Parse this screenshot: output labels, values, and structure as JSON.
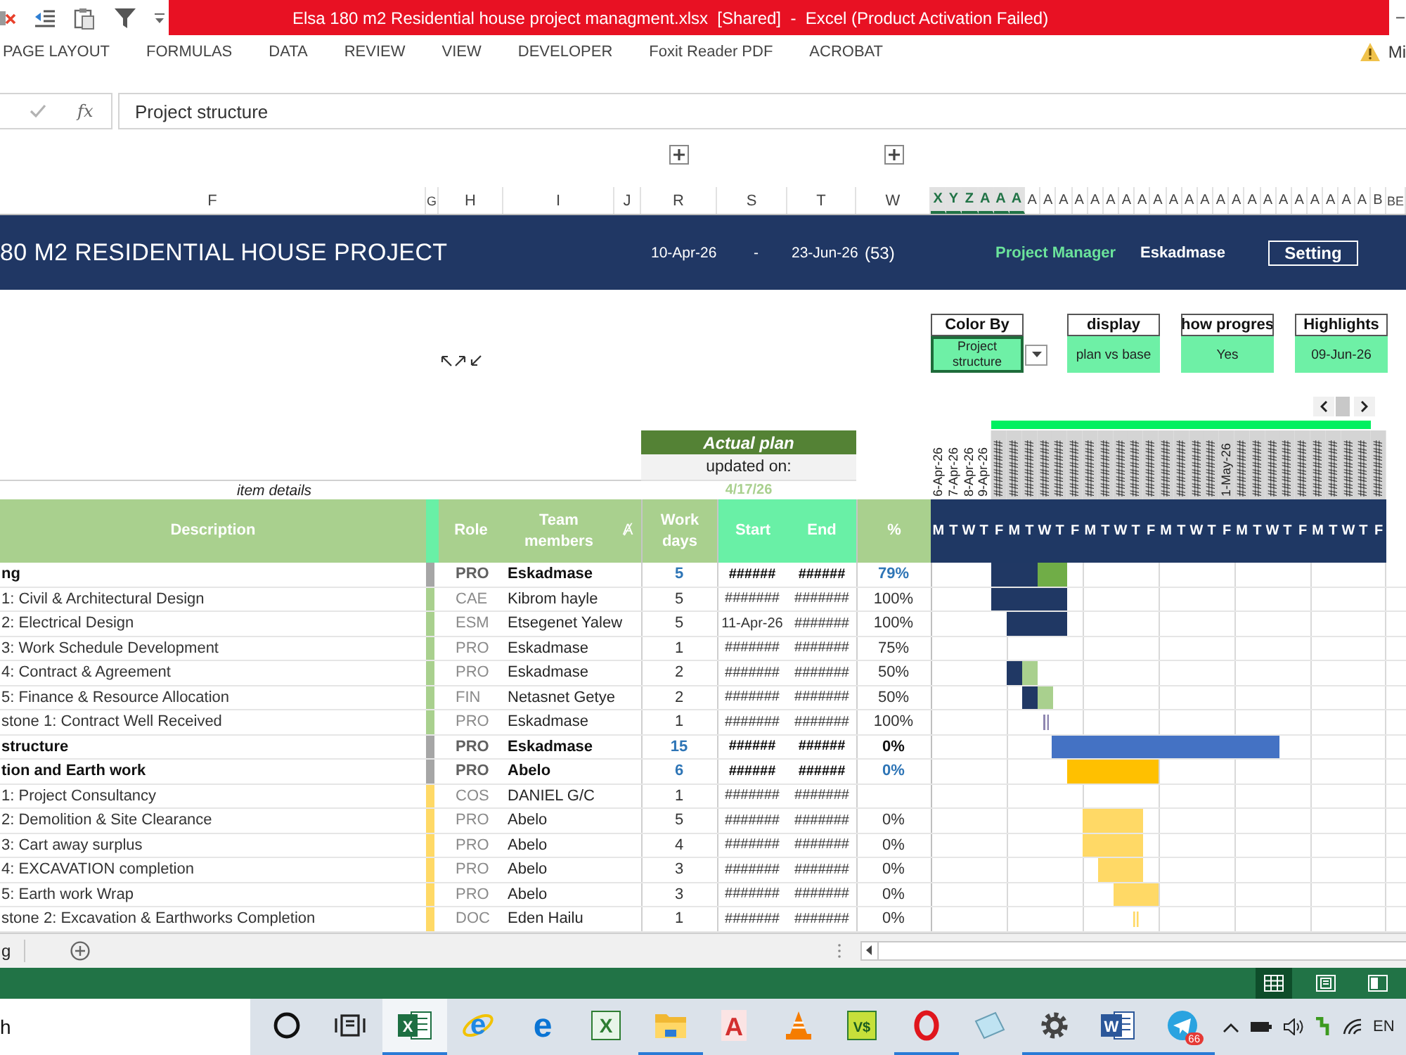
{
  "title_bar": {
    "title": "Elsa 180 m2 Residential house project managment.xlsx  [Shared]  -  Excel (Product Activation Failed)"
  },
  "ribbon": {
    "tabs": [
      {
        "label": "PAGE LAYOUT",
        "selected": false
      },
      {
        "label": "FORMULAS",
        "selected": false
      },
      {
        "label": "DATA",
        "selected": false
      },
      {
        "label": "REVIEW",
        "selected": false
      },
      {
        "label": "VIEW",
        "selected": false
      },
      {
        "label": "DEVELOPER",
        "selected": false
      },
      {
        "label": "Foxit Reader PDF",
        "selected": false
      },
      {
        "label": "ACROBAT",
        "selected": false
      }
    ],
    "account": "Mi"
  },
  "formula_bar": {
    "function_label": "fx",
    "content": "Project structure"
  },
  "column_headers": [
    {
      "label": "F",
      "selected": false
    },
    {
      "label": "G",
      "selected": false
    },
    {
      "label": "H",
      "selected": false
    },
    {
      "label": "I",
      "selected": false
    },
    {
      "label": "J",
      "selected": false
    },
    {
      "label": "R",
      "selected": false
    },
    {
      "label": "S",
      "selected": false
    },
    {
      "label": "T",
      "selected": false
    },
    {
      "label": "W",
      "selected": false
    },
    {
      "label": "X",
      "selected": true
    },
    {
      "label": "Y",
      "selected": true
    },
    {
      "label": "Z",
      "selected": true
    },
    {
      "label": "A",
      "selected": true
    },
    {
      "label": "A",
      "selected": true
    },
    {
      "label": "A",
      "selected": true
    },
    {
      "label": "A",
      "selected": false
    },
    {
      "label": "A",
      "selected": false
    },
    {
      "label": "A",
      "selected": false
    },
    {
      "label": "A",
      "selected": false
    },
    {
      "label": "A",
      "selected": false
    },
    {
      "label": "A",
      "selected": false
    },
    {
      "label": "A",
      "selected": false
    },
    {
      "label": "A",
      "selected": false
    },
    {
      "label": "A",
      "selected": false
    },
    {
      "label": "A",
      "selected": false
    },
    {
      "label": "A",
      "selected": false
    },
    {
      "label": "A",
      "selected": false
    },
    {
      "label": "A",
      "selected": false
    },
    {
      "label": "A",
      "selected": false
    },
    {
      "label": "A",
      "selected": false
    },
    {
      "label": "A",
      "selected": false
    },
    {
      "label": "A",
      "selected": false
    },
    {
      "label": "A",
      "selected": false
    },
    {
      "label": "A",
      "selected": false
    },
    {
      "label": "A",
      "selected": false
    },
    {
      "label": "A",
      "selected": false
    },
    {
      "label": "A",
      "selected": false
    },
    {
      "label": "B",
      "selected": false
    },
    {
      "label": "BE",
      "selected": false
    }
  ],
  "project_band": {
    "title": "80 M2 RESIDENTIAL HOUSE PROJECT",
    "start": "10-Apr-26",
    "separator": "-",
    "end": "23-Jun-26",
    "duration": "(53)",
    "manager_label": "Project Manager",
    "manager": "Eskadmase",
    "setting_button": "Setting"
  },
  "controls": [
    {
      "kind": "dropdown",
      "label": "Color By",
      "value": "Project structure",
      "selected": true
    },
    {
      "kind": "cell",
      "label": "display",
      "value": "plan vs base",
      "selected": false
    },
    {
      "kind": "cell",
      "label": "how progres",
      "value": "Yes",
      "selected": false
    },
    {
      "kind": "cell",
      "label": "Highlights",
      "value": "09-Jun-26",
      "selected": false
    }
  ],
  "actual_plan": {
    "title": "Actual plan",
    "updated_label": "updated on:",
    "updated_date": "4/17/26"
  },
  "item_details": "item details",
  "date_headers": [
    {
      "label": "6-Apr-26",
      "shaded": false
    },
    {
      "label": "7-Apr-26",
      "shaded": false
    },
    {
      "label": "8-Apr-26",
      "shaded": false
    },
    {
      "label": "9-Apr-26",
      "shaded": false
    },
    {
      "label": "########",
      "shaded": true
    },
    {
      "label": "########",
      "shaded": true
    },
    {
      "label": "########",
      "shaded": true
    },
    {
      "label": "########",
      "shaded": true
    },
    {
      "label": "########",
      "shaded": true
    },
    {
      "label": "########",
      "shaded": true
    },
    {
      "label": "########",
      "shaded": true
    },
    {
      "label": "########",
      "shaded": true
    },
    {
      "label": "########",
      "shaded": true
    },
    {
      "label": "########",
      "shaded": true
    },
    {
      "label": "########",
      "shaded": true
    },
    {
      "label": "########",
      "shaded": true
    },
    {
      "label": "########",
      "shaded": true
    },
    {
      "label": "########",
      "shaded": true
    },
    {
      "label": "########",
      "shaded": true
    },
    {
      "label": "1-May-26",
      "shaded": true
    },
    {
      "label": "########",
      "shaded": true
    },
    {
      "label": "########",
      "shaded": true
    },
    {
      "label": "########",
      "shaded": true
    },
    {
      "label": "########",
      "shaded": true
    },
    {
      "label": "########",
      "shaded": true
    },
    {
      "label": "########",
      "shaded": true
    },
    {
      "label": "########",
      "shaded": true
    },
    {
      "label": "########",
      "shaded": true
    },
    {
      "label": "########",
      "shaded": true
    },
    {
      "label": "########",
      "shaded": true
    }
  ],
  "table": {
    "columns": [
      "Description",
      "Role",
      "Team members",
      "Work days",
      "Start",
      "End",
      "%"
    ],
    "filter_mark": "Ⱥ",
    "weekdays": [
      "M",
      "T",
      "W",
      "T",
      "F",
      "M",
      "T",
      "W",
      "T",
      "F",
      "M",
      "T",
      "W",
      "T",
      "F",
      "M",
      "T",
      "W",
      "T",
      "F",
      "M",
      "T",
      "W",
      "T",
      "F",
      "M",
      "T",
      "W",
      "T",
      "F"
    ],
    "rows": [
      {
        "kind": "summary",
        "description": "ng",
        "color": "#a6a6a6",
        "role": "PRO",
        "member": "Eskadmase",
        "work_days": "5",
        "start": "######",
        "end": "######",
        "percent": "79%"
      },
      {
        "kind": "task",
        "description": "1: Civil & Architectural Design",
        "color": "#a9d08e",
        "role": "CAE",
        "member": "Kibrom hayle",
        "work_days": "5",
        "start": "#######",
        "end": "#######",
        "percent": "100%"
      },
      {
        "kind": "task",
        "description": "2: Electrical Design",
        "color": "#a9d08e",
        "role": "ESM",
        "member": "Etsegenet Yalew",
        "work_days": "5",
        "start": "11-Apr-26",
        "end": "#######",
        "percent": "100%"
      },
      {
        "kind": "task",
        "description": "3: Work Schedule Development",
        "color": "#a9d08e",
        "role": "PRO",
        "member": "Eskadmase",
        "work_days": "1",
        "start": "#######",
        "end": "#######",
        "percent": "75%"
      },
      {
        "kind": "task",
        "description": "4: Contract & Agreement",
        "color": "#a9d08e",
        "role": "PRO",
        "member": "Eskadmase",
        "work_days": "2",
        "start": "#######",
        "end": "#######",
        "percent": "50%"
      },
      {
        "kind": "task",
        "description": "5: Finance & Resource Allocation",
        "color": "#a9d08e",
        "role": "FIN",
        "member": "Netasnet Getye",
        "work_days": "2",
        "start": "#######",
        "end": "#######",
        "percent": "50%"
      },
      {
        "kind": "task",
        "description": "stone 1: Contract Well Received",
        "color": "#a9d08e",
        "role": "PRO",
        "member": "Eskadmase",
        "work_days": "1",
        "start": "#######",
        "end": "#######",
        "percent": "100%"
      },
      {
        "kind": "project",
        "description": "structure",
        "color": "#a6a6a6",
        "role": "PRO",
        "member": "Eskadmase",
        "work_days": "15",
        "start": "######",
        "end": "######",
        "percent": "0%"
      },
      {
        "kind": "summary",
        "description": "tion and Earth work",
        "color": "#a6a6a6",
        "role": "PRO",
        "member": "Abelo",
        "work_days": "6",
        "start": "######",
        "end": "######",
        "percent": "0%"
      },
      {
        "kind": "task",
        "description": "1: Project Consultancy",
        "color": "#ffd966",
        "role": "COS",
        "member": "DANIEL G/C",
        "work_days": "1",
        "start": "#######",
        "end": "#######"
      },
      {
        "kind": "task",
        "description": "2: Demolition & Site Clearance",
        "color": "#ffd966",
        "role": "PRO",
        "member": "Abelo",
        "work_days": "5",
        "start": "#######",
        "end": "#######",
        "percent": "0%"
      },
      {
        "kind": "task",
        "description": "3: Cart away surplus",
        "color": "#ffd966",
        "role": "PRO",
        "member": "Abelo",
        "work_days": "4",
        "start": "#######",
        "end": "#######",
        "percent": "0%"
      },
      {
        "kind": "task",
        "description": "4: EXCAVATION completion",
        "color": "#ffd966",
        "role": "PRO",
        "member": "Abelo",
        "work_days": "3",
        "start": "#######",
        "end": "#######",
        "percent": "0%"
      },
      {
        "kind": "task",
        "description": "5: Earth work Wrap",
        "color": "#ffd966",
        "role": "PRO",
        "member": "Abelo",
        "work_days": "3",
        "start": "#######",
        "end": "#######",
        "percent": "0%"
      },
      {
        "kind": "task",
        "description": "stone 2: Excavation & Earthworks Completion",
        "color": "#ffd966",
        "role": "DOC",
        "member": "Eden Hailu",
        "work_days": "1",
        "start": "#######",
        "end": "#######",
        "percent": "0%"
      }
    ]
  },
  "sheet_bar": {
    "tab": "g"
  },
  "status_bar": {
    "views": [
      {
        "kind": "normal",
        "selected": true
      },
      {
        "kind": "layout",
        "selected": false
      },
      {
        "kind": "pagebreak",
        "selected": false
      }
    ]
  },
  "taskbar": {
    "search": {
      "placeholder": "h"
    },
    "apps": [
      {
        "kind": "ring",
        "running": false,
        "selected": false
      },
      {
        "kind": "tasks",
        "running": false,
        "selected": false
      },
      {
        "kind": "sheet",
        "glyph": "X",
        "running": true,
        "selected": true
      },
      {
        "kind": "globe",
        "glyph": "e",
        "running": false,
        "selected": false
      },
      {
        "kind": "edge",
        "glyph": "e",
        "running": false,
        "selected": false
      },
      {
        "kind": "chart",
        "glyph": "X",
        "running": false,
        "selected": false
      },
      {
        "kind": "folder",
        "running": true,
        "selected": false
      },
      {
        "kind": "reader",
        "glyph": "A",
        "running": false,
        "selected": false
      },
      {
        "kind": "cone",
        "running": false,
        "selected": false
      },
      {
        "kind": "money",
        "glyph": "V$",
        "running": false,
        "selected": false
      },
      {
        "kind": "oring",
        "running": true,
        "selected": false
      },
      {
        "kind": "notepad",
        "running": false,
        "selected": false
      },
      {
        "kind": "gear",
        "running": true,
        "selected": false
      },
      {
        "kind": "word",
        "glyph": "W",
        "running": true,
        "selected": false
      },
      {
        "kind": "plane",
        "badge": "66",
        "running": true,
        "selected": false
      }
    ],
    "language": "EN"
  }
}
